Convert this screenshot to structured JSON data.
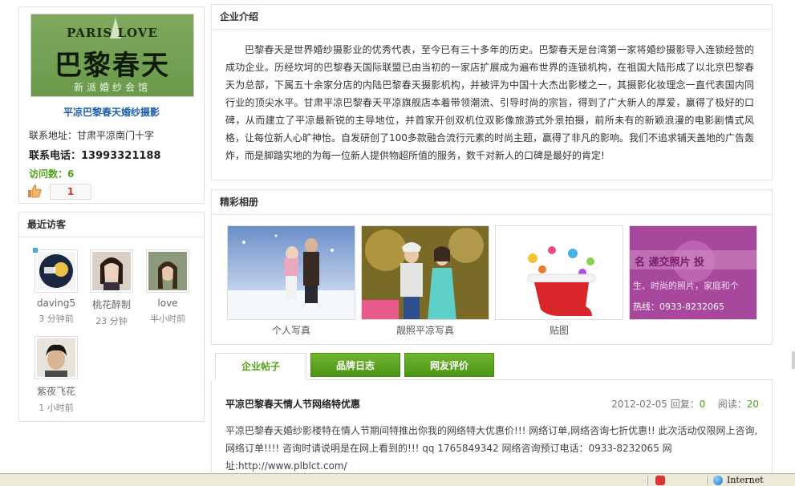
{
  "profile": {
    "logo_top": "PARIS LOVE",
    "logo_big": "巴黎春天",
    "logo_sub": "新派婚纱会馆",
    "name": "平凉巴黎春天婚纱摄影",
    "address": "联系地址：甘肃平凉南门十字",
    "phone": "联系电话：13993321188",
    "visits": "访问数：6",
    "likes": "1"
  },
  "visitors": {
    "title": "最近访客",
    "items": [
      {
        "name": "daving5",
        "time": "3 分钟前"
      },
      {
        "name": "桃花醉制",
        "time": "23 分钟"
      },
      {
        "name": "love",
        "time": "半小时前"
      },
      {
        "name": "紫夜飞花",
        "time": "1 小时前"
      }
    ]
  },
  "intro": {
    "title": "企业介绍",
    "text": "巴黎春天是世界婚纱摄影业的优秀代表，至今已有三十多年的历史。巴黎春天是台湾第一家将婚纱摄影导入连锁经营的成功企业。历经坎坷的巴黎春天国际联盟已由当初的一家店扩展成为遍布世界的连锁机构，在祖国大陆形成了以北京巴黎春天为总部，下属五十余家分店的内陆巴黎春天摄影机构，并被评为中国十大杰出影楼之一，其摄影化妆理念一直代表国内同行业的顶尖水平。甘肃平凉巴黎春天平凉旗舰店本着带领潮流、引导时尚的宗旨，得到了广大新人的厚爱，赢得了极好的口碑，从而建立了平凉最新锐的主导地位，并首家开创双机位双影像旅游式外景拍摄，前所未有的新颖浪漫的电影剧情式风格，让每位新人心旷神怡。自发研创了100多款融合流行元素的时尚主题，赢得了非凡的影响。我们不追求铺天盖地的广告轰炸，而是脚踏实地的为每一位新人提供物超所值的服务，数千对新人的口碑是最好的肯定!"
  },
  "album": {
    "title": "精彩相册",
    "photos": [
      {
        "caption": "个人写真"
      },
      {
        "caption": "靓照平凉写真"
      },
      {
        "caption": "贴图"
      },
      {
        "caption": "",
        "overlay_text": "名  递交照片  投",
        "overlay_line2": "生、时尚的照片，家庭和个",
        "overlay_line3": "热线：0933-8232065"
      }
    ]
  },
  "tabs": [
    {
      "label": "企业帖子"
    },
    {
      "label": "品牌日志"
    },
    {
      "label": "网友评价"
    }
  ],
  "post": {
    "title": "平凉巴黎春天情人节网络特优惠",
    "date": "2012-02-05",
    "reply_label": "回复：",
    "replies": "0",
    "read_label": "阅读：",
    "reads": "20",
    "body": "平凉巴黎春天婚纱影楼特在情人节期间特推出你我的网络特大优惠价!!! 网络订单,网络咨询七折优惠!! 此次活动仅限网上咨询,网络订单!!!! 咨询时请说明是在网上看到的!!! qq 1765849342 网络咨询预订电话：0933-8232065 网址:http://www.plblct.com/"
  },
  "status": {
    "zone": "Internet"
  },
  "colors": {
    "accent_green": "#55a11a",
    "link_blue": "#1b5fa8",
    "tab_green": "#5aa020"
  }
}
